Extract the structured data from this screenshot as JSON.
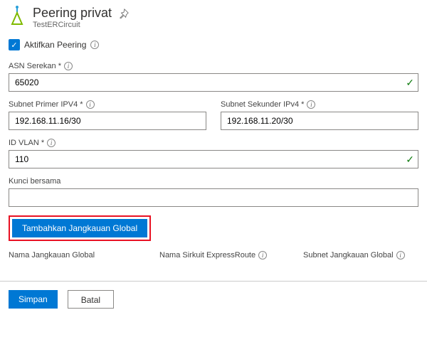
{
  "header": {
    "title": "Peering privat",
    "subtitle": "TestERCircuit"
  },
  "enable": {
    "label": "Aktifkan Peering"
  },
  "fields": {
    "asn": {
      "label": "ASN Serekan *",
      "value": "65020"
    },
    "primary": {
      "label": "Subnet Primer IPV4 *",
      "value": "192.168.11.16/30"
    },
    "secondary": {
      "label": "Subnet Sekunder IPv4 *",
      "value": "192.168.11.20/30"
    },
    "vlan": {
      "label": "ID VLAN *",
      "value": "110"
    },
    "sharedkey": {
      "label": "Kunci bersama",
      "value": ""
    }
  },
  "buttons": {
    "addGlobal": "Tambahkan Jangkauan Global",
    "save": "Simpan",
    "cancel": "Batal"
  },
  "columns": {
    "globalName": "Nama Jangkauan Global",
    "circuitName": "Nama Sirkuit ExpressRoute",
    "globalSubnet": "Subnet Jangkauan Global"
  }
}
